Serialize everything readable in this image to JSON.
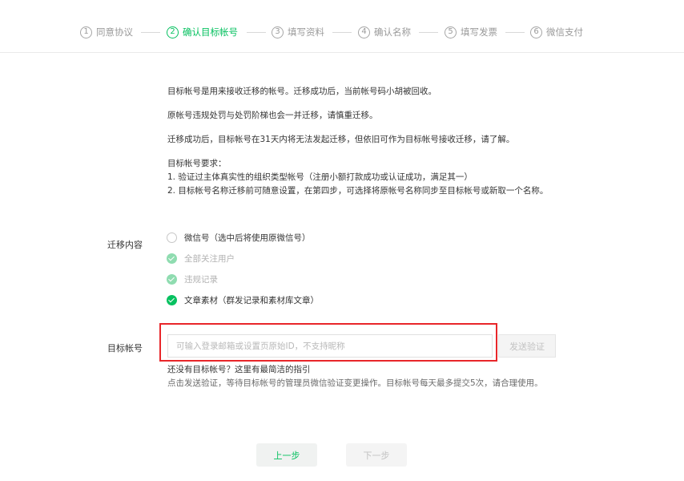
{
  "steps": [
    {
      "num": "1",
      "label": "同意协议"
    },
    {
      "num": "2",
      "label": "确认目标帐号"
    },
    {
      "num": "3",
      "label": "填写资料"
    },
    {
      "num": "4",
      "label": "确认名称"
    },
    {
      "num": "5",
      "label": "填写发票"
    },
    {
      "num": "6",
      "label": "微信支付"
    }
  ],
  "active_step": 2,
  "info": {
    "line1": "目标帐号是用来接收迁移的帐号。迁移成功后，当前帐号码小胡被回收。",
    "line2": "原帐号违规处罚与处罚阶梯也会一并迁移，请慎重迁移。",
    "line3": "迁移成功后，目标帐号在31天内将无法发起迁移，但依旧可作为目标帐号接收迁移，请了解。",
    "req_title": "目标帐号要求：",
    "req1": "1. 验证过主体真实性的组织类型帐号（注册小额打款成功或认证成功，满足其一）",
    "req2": "2. 目标帐号名称迁移前可随意设置，在第四步，可选择将原帐号名称同步至目标帐号或新取一个名称。"
  },
  "migrate": {
    "label": "迁移内容",
    "options": [
      {
        "label": "微信号（选中后将使用原微信号）",
        "state": "unchecked"
      },
      {
        "label": "全部关注用户",
        "state": "checked-disabled"
      },
      {
        "label": "违规记录",
        "state": "checked-disabled"
      },
      {
        "label": "文章素材（群发记录和素材库文章）",
        "state": "checked"
      }
    ]
  },
  "target": {
    "label": "目标帐号",
    "placeholder": "可输入登录邮箱或设置页原始ID，不支持昵称",
    "value": "",
    "send_label": "发送验证",
    "help_link": "还没有目标帐号？这里有最简洁的指引",
    "help_text": "点击发送验证，等待目标帐号的管理员微信验证变更操作。目标帐号每天最多提交5次，请合理使用。"
  },
  "buttons": {
    "prev": "上一步",
    "next": "下一步"
  },
  "colors": {
    "accent": "#07c160",
    "highlight": "#e8262a"
  }
}
